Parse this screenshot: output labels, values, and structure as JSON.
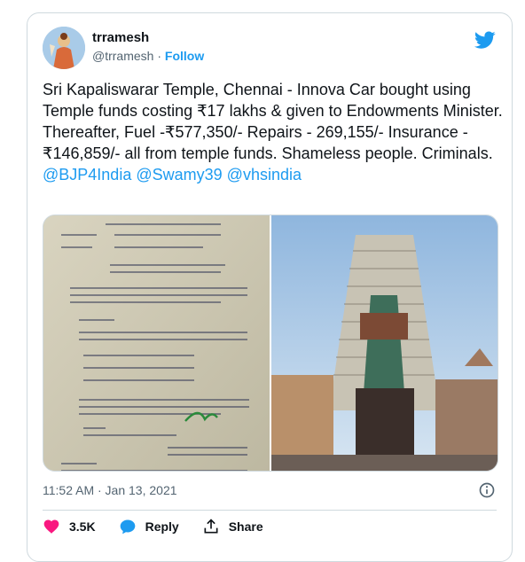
{
  "author": {
    "name": "trramesh",
    "handle": "@trramesh",
    "separator": "·",
    "follow_label": "Follow"
  },
  "tweet": {
    "text": "Sri Kapaliswarar Temple, Chennai - Innova Car bought using Temple funds costing ₹17 lakhs & given to Endowments Minister. Thereafter, Fuel -₹577,350/- Repairs - 269,155/- Insurance - ₹146,859/- all from temple funds. Shameless people. Criminals. ",
    "mentions": [
      "@BJP4India",
      "@Swamy39",
      "@vhsindia"
    ],
    "timestamp": "11:52 AM · Jan 13, 2021"
  },
  "actions": {
    "like_count": "3.5K",
    "reply_label": "Reply",
    "share_label": "Share"
  },
  "colors": {
    "accent": "#1d9bf0",
    "like": "#f91880",
    "muted": "#536471"
  }
}
